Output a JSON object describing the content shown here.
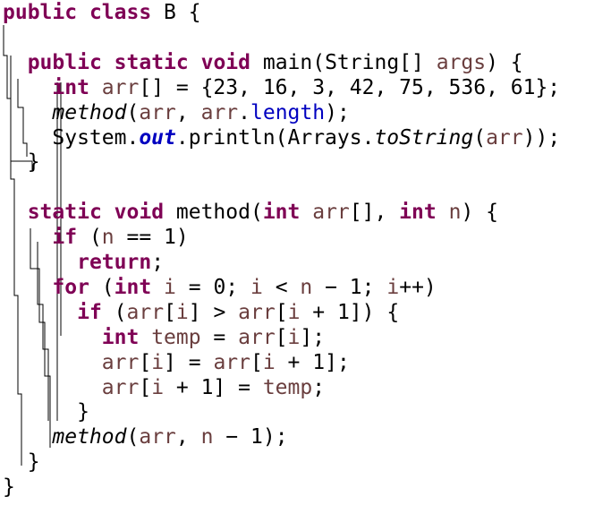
{
  "code": {
    "language": "java",
    "colors": {
      "keyword": "#7f0055",
      "local_variable": "#6a3e3e",
      "field": "#0000c0",
      "default": "#000000",
      "background": "#ffffff"
    },
    "lines": [
      [
        {
          "t": "public",
          "c": "kw"
        },
        {
          "t": " "
        },
        {
          "t": "class",
          "c": "kw"
        },
        {
          "t": " B {"
        }
      ],
      [],
      [
        {
          "t": "  "
        },
        {
          "t": "public",
          "c": "kw"
        },
        {
          "t": " "
        },
        {
          "t": "static",
          "c": "kw"
        },
        {
          "t": " "
        },
        {
          "t": "void",
          "c": "kw"
        },
        {
          "t": " main(String[] "
        },
        {
          "t": "args",
          "c": "var"
        },
        {
          "t": ") {"
        }
      ],
      [
        {
          "t": "    "
        },
        {
          "t": "int",
          "c": "kw"
        },
        {
          "t": " "
        },
        {
          "t": "arr",
          "c": "var"
        },
        {
          "t": "[] = {23, 16, 3, 42, 75, 536, 61};"
        }
      ],
      [
        {
          "t": "    "
        },
        {
          "t": "method",
          "c": "it"
        },
        {
          "t": "("
        },
        {
          "t": "arr",
          "c": "var"
        },
        {
          "t": ", "
        },
        {
          "t": "arr",
          "c": "var"
        },
        {
          "t": "."
        },
        {
          "t": "length",
          "c": "fld"
        },
        {
          "t": ");"
        }
      ],
      [
        {
          "t": "    System."
        },
        {
          "t": "out",
          "c": "sfld"
        },
        {
          "t": ".println(Arrays."
        },
        {
          "t": "toString",
          "c": "it"
        },
        {
          "t": "("
        },
        {
          "t": "arr",
          "c": "var"
        },
        {
          "t": "));"
        }
      ],
      [
        {
          "t": "  }"
        }
      ],
      [],
      [
        {
          "t": "  "
        },
        {
          "t": "static",
          "c": "kw"
        },
        {
          "t": " "
        },
        {
          "t": "void",
          "c": "kw"
        },
        {
          "t": " method("
        },
        {
          "t": "int",
          "c": "kw"
        },
        {
          "t": " "
        },
        {
          "t": "arr",
          "c": "var"
        },
        {
          "t": "[], "
        },
        {
          "t": "int",
          "c": "kw"
        },
        {
          "t": " "
        },
        {
          "t": "n",
          "c": "var"
        },
        {
          "t": ") {"
        }
      ],
      [
        {
          "t": "    "
        },
        {
          "t": "if",
          "c": "kw"
        },
        {
          "t": " ("
        },
        {
          "t": "n",
          "c": "var"
        },
        {
          "t": " == 1)"
        }
      ],
      [
        {
          "t": "      "
        },
        {
          "t": "return",
          "c": "kw"
        },
        {
          "t": ";"
        }
      ],
      [
        {
          "t": "    "
        },
        {
          "t": "for",
          "c": "kw"
        },
        {
          "t": " ("
        },
        {
          "t": "int",
          "c": "kw"
        },
        {
          "t": " "
        },
        {
          "t": "i",
          "c": "var"
        },
        {
          "t": " = 0; "
        },
        {
          "t": "i",
          "c": "var"
        },
        {
          "t": " < "
        },
        {
          "t": "n",
          "c": "var"
        },
        {
          "t": " − 1; "
        },
        {
          "t": "i",
          "c": "var"
        },
        {
          "t": "++)"
        }
      ],
      [
        {
          "t": "      "
        },
        {
          "t": "if",
          "c": "kw"
        },
        {
          "t": " ("
        },
        {
          "t": "arr",
          "c": "var"
        },
        {
          "t": "["
        },
        {
          "t": "i",
          "c": "var"
        },
        {
          "t": "] > "
        },
        {
          "t": "arr",
          "c": "var"
        },
        {
          "t": "["
        },
        {
          "t": "i",
          "c": "var"
        },
        {
          "t": " + 1]) {"
        }
      ],
      [
        {
          "t": "        "
        },
        {
          "t": "int",
          "c": "kw"
        },
        {
          "t": " "
        },
        {
          "t": "temp",
          "c": "var"
        },
        {
          "t": " = "
        },
        {
          "t": "arr",
          "c": "var"
        },
        {
          "t": "["
        },
        {
          "t": "i",
          "c": "var"
        },
        {
          "t": "];"
        }
      ],
      [
        {
          "t": "        "
        },
        {
          "t": "arr",
          "c": "var"
        },
        {
          "t": "["
        },
        {
          "t": "i",
          "c": "var"
        },
        {
          "t": "] = "
        },
        {
          "t": "arr",
          "c": "var"
        },
        {
          "t": "["
        },
        {
          "t": "i",
          "c": "var"
        },
        {
          "t": " + 1];"
        }
      ],
      [
        {
          "t": "        "
        },
        {
          "t": "arr",
          "c": "var"
        },
        {
          "t": "["
        },
        {
          "t": "i",
          "c": "var"
        },
        {
          "t": " + 1] = "
        },
        {
          "t": "temp",
          "c": "var"
        },
        {
          "t": ";"
        }
      ],
      [
        {
          "t": "      }"
        }
      ],
      [
        {
          "t": "    "
        },
        {
          "t": "method",
          "c": "it"
        },
        {
          "t": "("
        },
        {
          "t": "arr",
          "c": "var"
        },
        {
          "t": ", "
        },
        {
          "t": "n",
          "c": "var"
        },
        {
          "t": " − 1);"
        }
      ],
      [
        {
          "t": "  }"
        }
      ],
      [
        {
          "t": "}"
        }
      ]
    ]
  }
}
